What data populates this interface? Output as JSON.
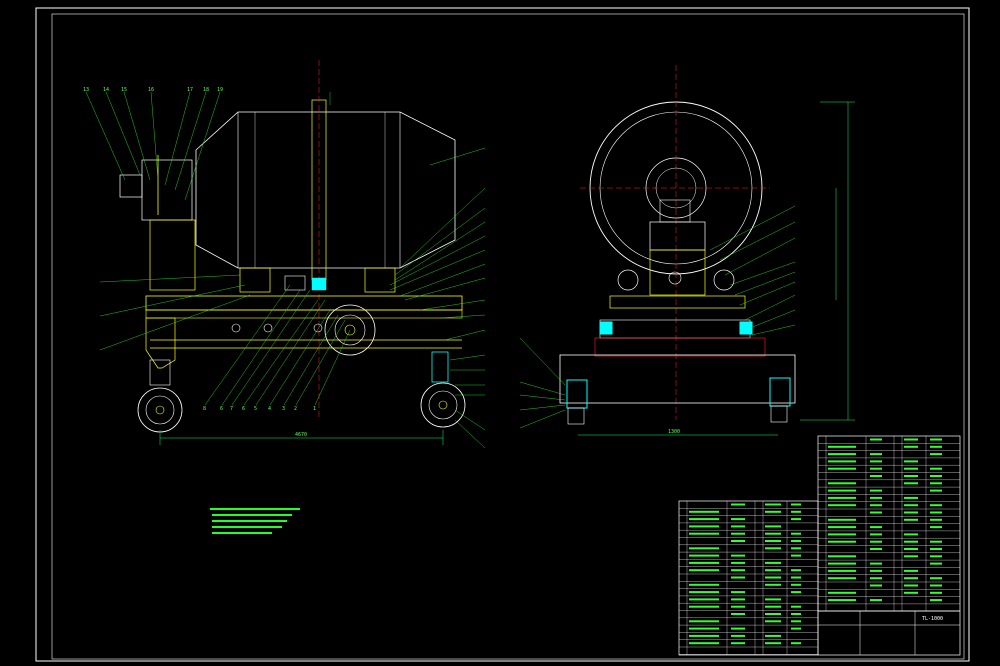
{
  "drawing": {
    "colors": {
      "border": "#ffffff",
      "leader": "#22ff22",
      "frame": "#ffff44",
      "body": "#ffffff",
      "centerline": "#ff2222",
      "part": "#00ffff",
      "table": "#ffffff",
      "table_text": "#33ff33",
      "dim": "#00ff66"
    },
    "title_block": {
      "drawing_no": "TL-1000"
    },
    "side_view_balloons_top": [
      "13",
      "14",
      "15",
      "16",
      "17",
      "18",
      "19"
    ],
    "side_view_balloons_bottom": [
      "8",
      "6",
      "7",
      "6",
      "5",
      "4",
      "3",
      "2",
      "1"
    ],
    "dimensions": {
      "side_length": "4670",
      "front_width": "1300"
    }
  }
}
